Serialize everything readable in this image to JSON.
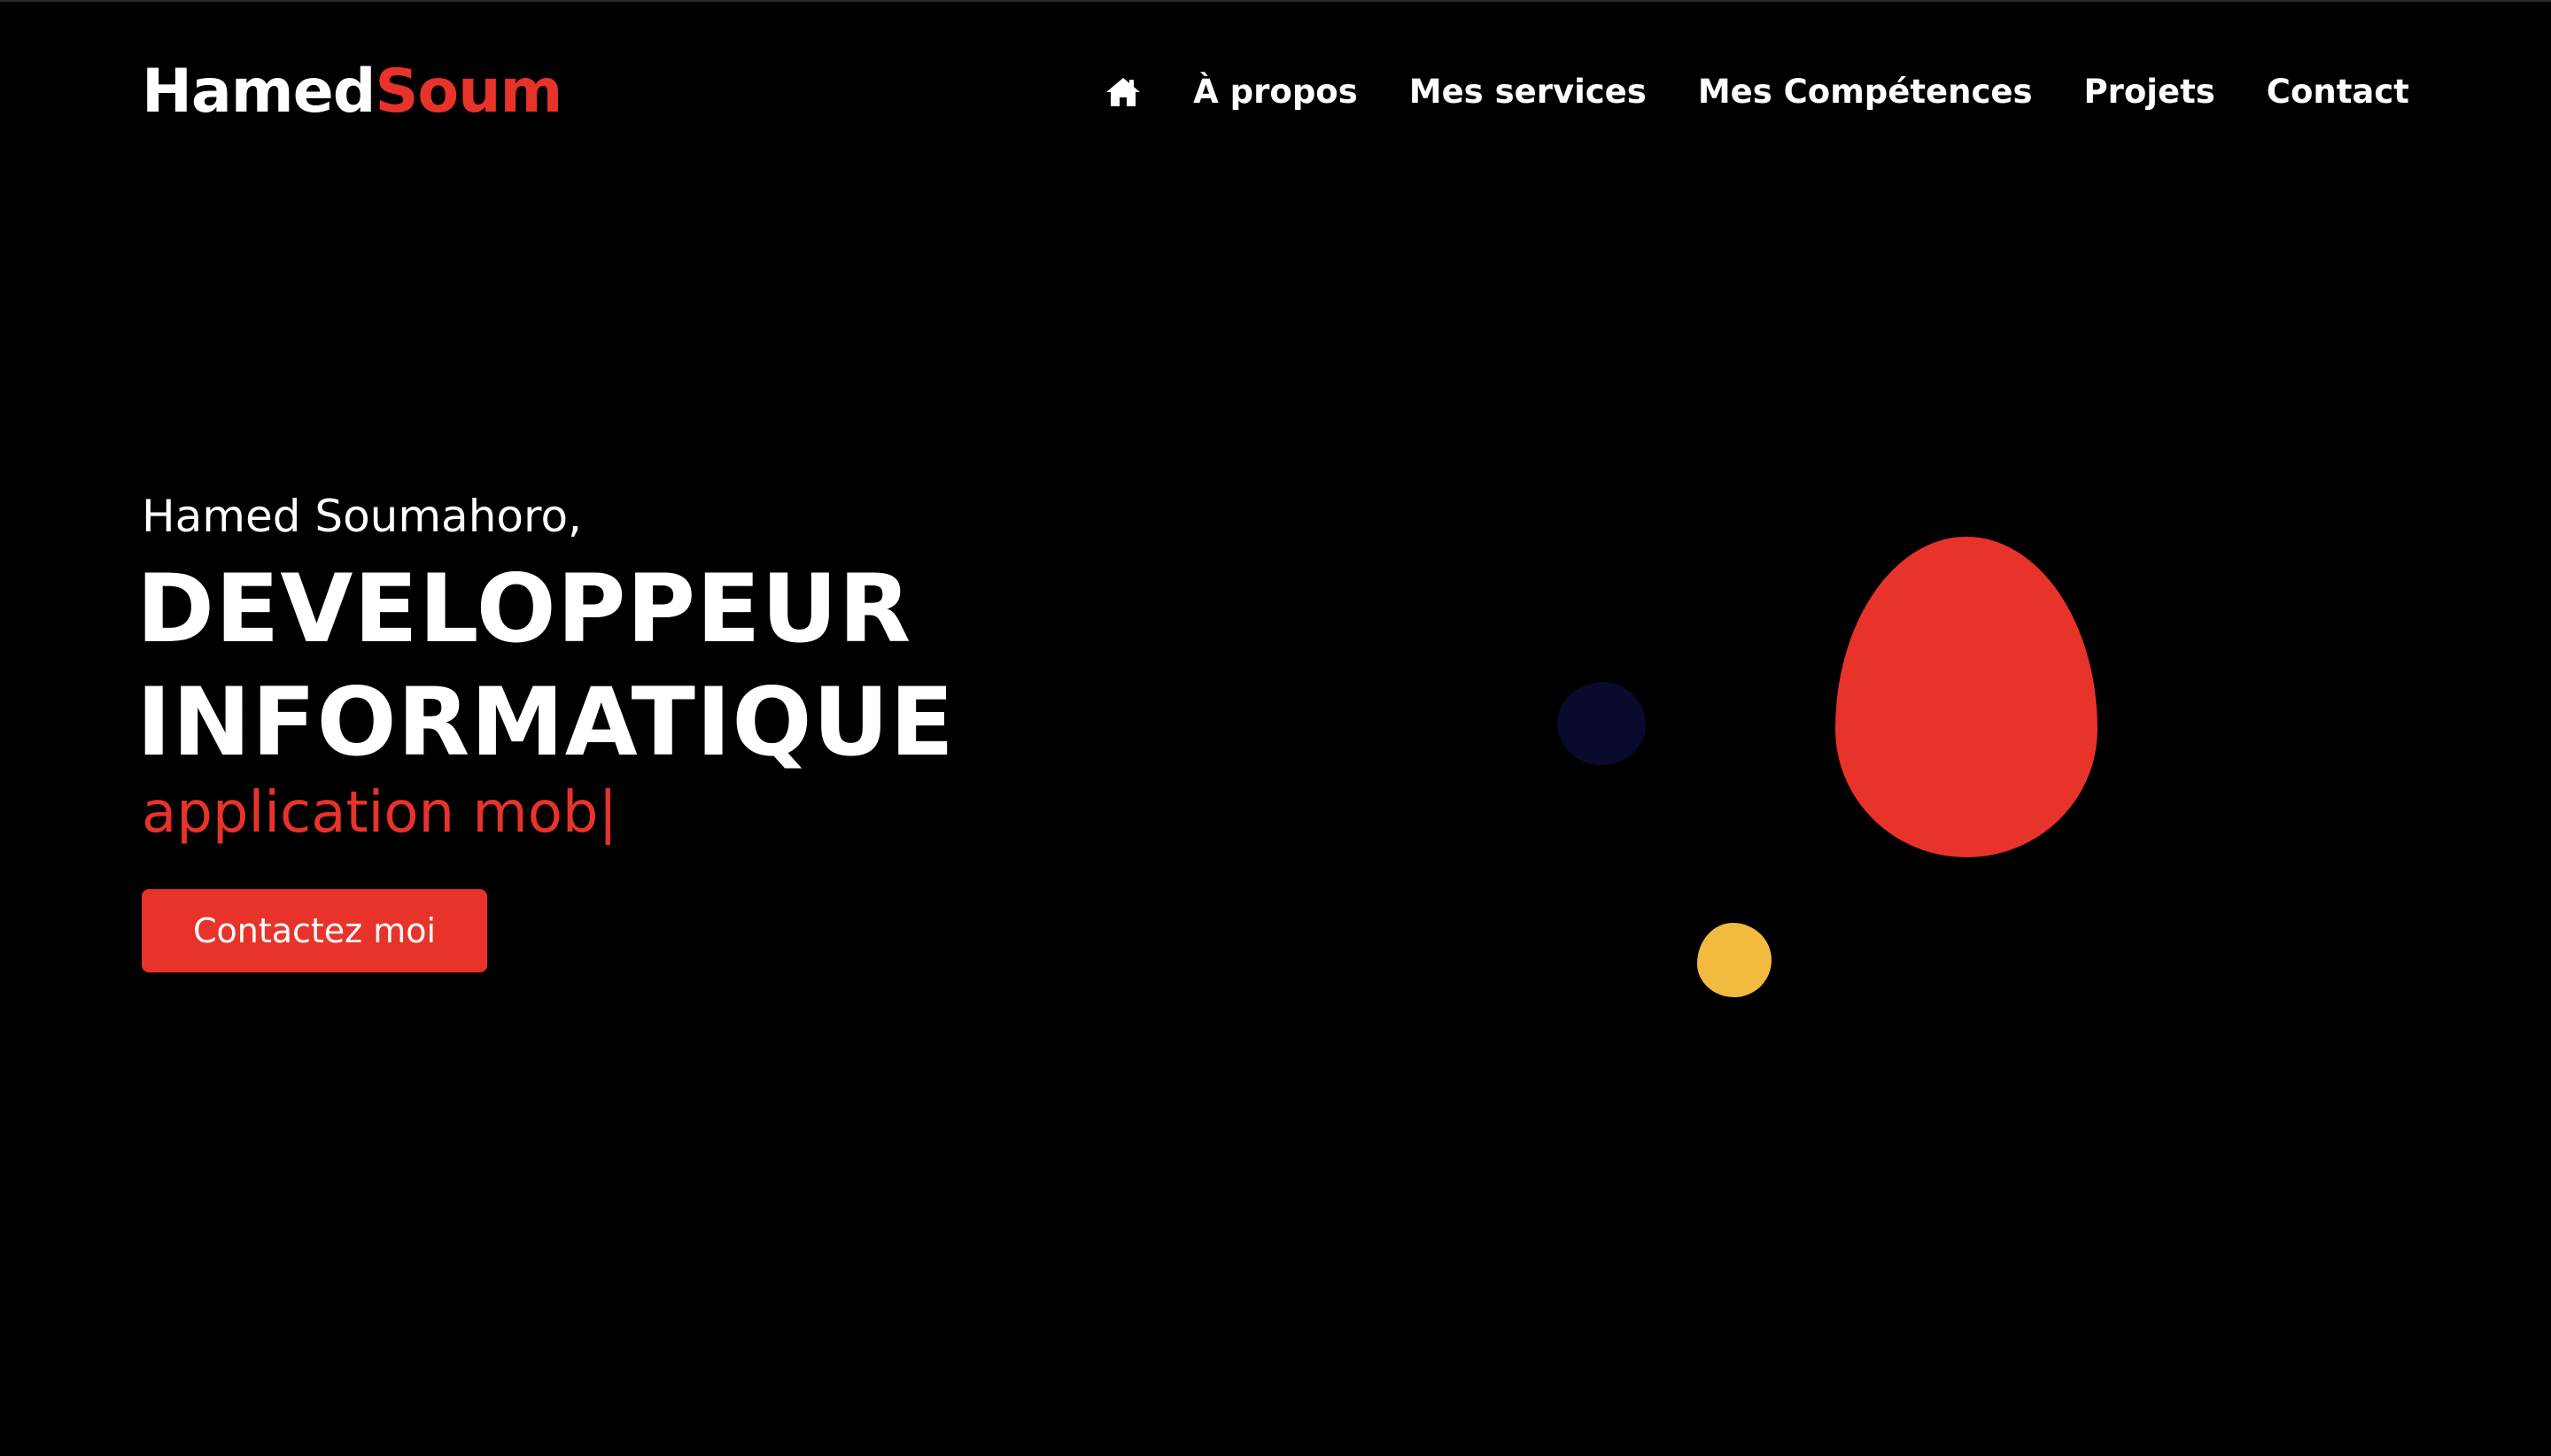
{
  "header": {
    "logo_first": "Hamed",
    "logo_second": "Soum",
    "nav": {
      "home_icon": "home-icon",
      "items": [
        {
          "label": "À propos"
        },
        {
          "label": "Mes services"
        },
        {
          "label": "Mes Compétences"
        },
        {
          "label": "Projets"
        },
        {
          "label": "Contact"
        }
      ]
    }
  },
  "hero": {
    "greeting": "Hamed Soumahoro,",
    "title_line1": "DEVELOPPEUR",
    "title_line2": "INFORMATIQUE",
    "typed_text": "application mob",
    "cursor": "|",
    "cta_label": "Contactez moi"
  },
  "colors": {
    "background": "#000000",
    "accent": "#e8332a",
    "text": "#ffffff",
    "blob_navy": "#0a0a2e",
    "blob_yellow": "#f2bb3f"
  }
}
